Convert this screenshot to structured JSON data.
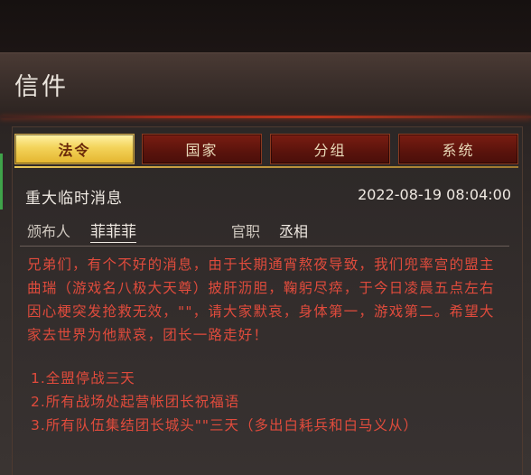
{
  "window": {
    "title": "信件"
  },
  "tabs": [
    {
      "label": "法令",
      "active": true
    },
    {
      "label": "国家",
      "active": false
    },
    {
      "label": "分组",
      "active": false
    },
    {
      "label": "系统",
      "active": false
    }
  ],
  "message": {
    "title": "重大临时消息",
    "timestamp": "2022-08-19 08:04:00",
    "sender_label": "颁布人",
    "sender_name": "菲菲菲",
    "post_label": "官职",
    "post_value": "丞相",
    "body": "兄弟们，有个不好的消息，由于长期通宵熬夜导致，我们兜率宫的盟主曲瑞（游戏名八极大天尊）披肝沥胆，鞠躬尽瘁，于今日凌晨五点左右因心梗突发抢救无效，\"\"，请大家默哀，身体第一，游戏第二。希望大家去世界为他默哀，团长一路走好！",
    "list_items": [
      "1.全盟停战三天",
      "2.所有战场处起营帐团长祝福语",
      "3.所有队伍集结团长城头\"\"三天（多出白耗兵和白马义从）"
    ]
  },
  "colors": {
    "body_text": "#e04b3c",
    "active_tab": "#f3d35a",
    "inactive_tab": "#5a130c",
    "title_accent": "#b8341c"
  }
}
